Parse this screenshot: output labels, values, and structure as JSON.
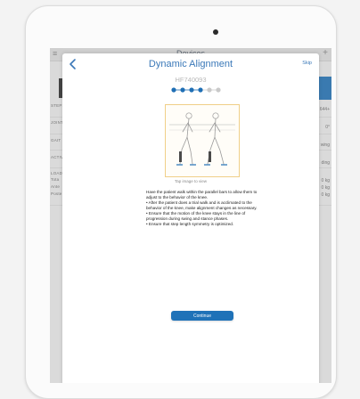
{
  "background": {
    "header_title": "Devices",
    "menu_icon": "hamburger-icon",
    "plus_icon": "plus-icon",
    "rows": [
      {
        "label": "STEPS",
        "value": "644+"
      },
      {
        "label": "JOINT",
        "value": "0°"
      },
      {
        "label": "GAIT",
        "value": "wing"
      },
      {
        "label": "ACTIV",
        "value": "ding"
      },
      {
        "label": "LOAD",
        "value": ""
      },
      {
        "label": "Tota",
        "value": "0 kg"
      },
      {
        "label": "Ante",
        "value": "0 kg"
      },
      {
        "label": "Poste",
        "value": "0 kg"
      }
    ]
  },
  "modal": {
    "back_icon": "chevron-left-icon",
    "title": "Dynamic Alignment",
    "skip_label": "Skip",
    "serial": "HF740093",
    "steps": {
      "total": 6,
      "completed": 4
    },
    "image_caption": "Tap image to view",
    "instructions": [
      "Have the patient walk within the parallel bars to allow them to adjust to the behavior of the knee.",
      "• After the patient does a trial walk and is acclimated to the behavior of the knee, make alignment changes as necessary.",
      "• Ensure that the motion of the knee stays in the line of progression during swing and stance phases.",
      "• Ensure that step length symmetry is optimized."
    ],
    "continue_label": "Continue",
    "accent_color": "#1f72b8",
    "image_border_color": "#f0cf88"
  }
}
